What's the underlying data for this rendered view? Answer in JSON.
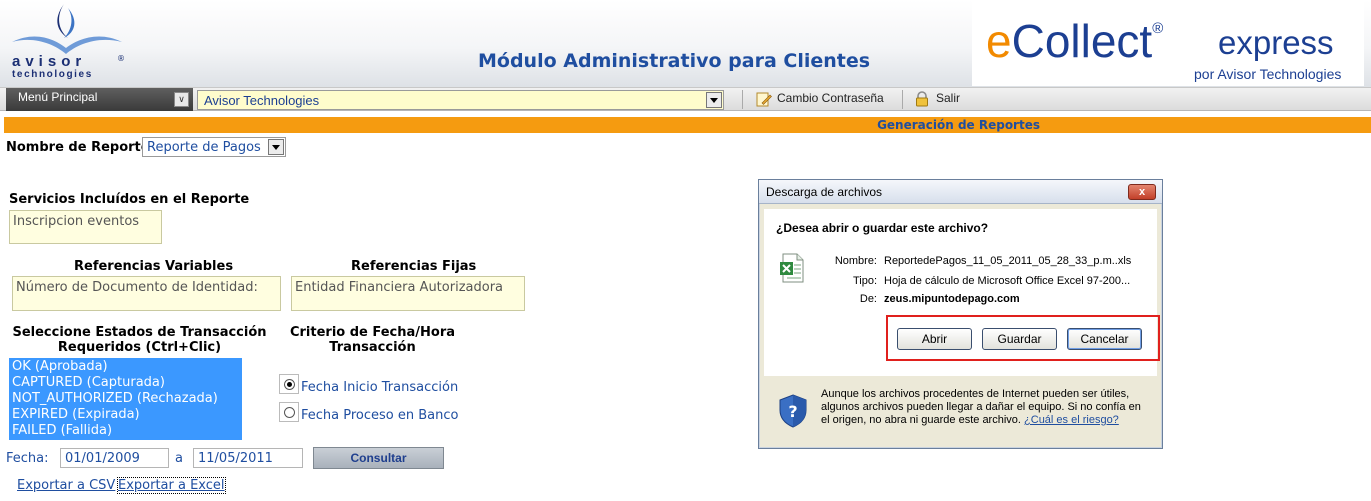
{
  "header": {
    "logo_word": "avisor",
    "logo_reg": "®",
    "logo_sub": "technologies",
    "title": "Módulo Administrativo para Clientes",
    "brand_e": "e",
    "brand_rest": "Collect",
    "brand_reg": "®",
    "brand_express": "express",
    "brand_by": "por Avisor Technologies"
  },
  "toolbar": {
    "menu_label": "Menú Principal",
    "client_value": "Avisor Technologies",
    "change_password": "Cambio Contraseña",
    "logout": "Salir"
  },
  "section": {
    "title": "Generación de Reportes"
  },
  "form": {
    "report_name_label": "Nombre de Reporte:",
    "report_value": "Reporte de Pagos",
    "services_label": "Servicios Incluídos en el Reporte",
    "services_value": "Inscripcion eventos",
    "variable_refs_label": "Referencias Variables",
    "variable_refs_value": "Número de Documento de Identidad:",
    "fixed_refs_label": "Referencias Fijas",
    "fixed_refs_value": "Entidad Financiera Autorizadora",
    "states_label_1": "Seleccione Estados de Transacción",
    "states_label_2": "Requeridos (Ctrl+Clic)",
    "states": [
      "OK (Aprobada)",
      "CAPTURED (Capturada)",
      "NOT_AUTHORIZED (Rechazada)",
      "EXPIRED (Expirada)",
      "FAILED (Fallida)"
    ],
    "date_criteria_label_1": "Criterio de Fecha/Hora",
    "date_criteria_label_2": "Transacción",
    "radio_start": "Fecha Inicio Transacción",
    "radio_bank": "Fecha Proceso en Banco",
    "date_label": "Fecha:",
    "date_from": "01/01/2009",
    "date_sep": "a",
    "date_to": "11/05/2011",
    "consult_button": "Consultar",
    "export_csv": "Exportar a CSV",
    "export_excel": "Exportar a Excel"
  },
  "dialog": {
    "title": "Descarga de archivos",
    "close": "x",
    "question": "¿Desea abrir o guardar este archivo?",
    "name_key": "Nombre:",
    "name_value": "ReportedePagos_11_05_2011_05_28_33_p.m..xls",
    "type_key": "Tipo:",
    "type_value": "Hoja de cálculo de Microsoft Office Excel 97-200...",
    "from_key": "De:",
    "from_value": "zeus.mipuntodepago.com",
    "open_button": "Abrir",
    "save_button": "Guardar",
    "cancel_button": "Cancelar",
    "warning_l1": "Aunque los archivos procedentes de Internet pueden ser útiles,",
    "warning_l2": "algunos archivos pueden llegar a dañar el equipo. Si no confía en",
    "warning_l3": "el origen, no abra ni guarde este archivo.",
    "risk_link": "¿Cuál es el riesgo?"
  },
  "colors": {
    "accent_orange": "#f59b10",
    "brand_blue": "#1f4ea0",
    "selection_blue": "#3b98ff",
    "input_yellow": "#fffee0",
    "highlight_red": "#e0201d"
  }
}
